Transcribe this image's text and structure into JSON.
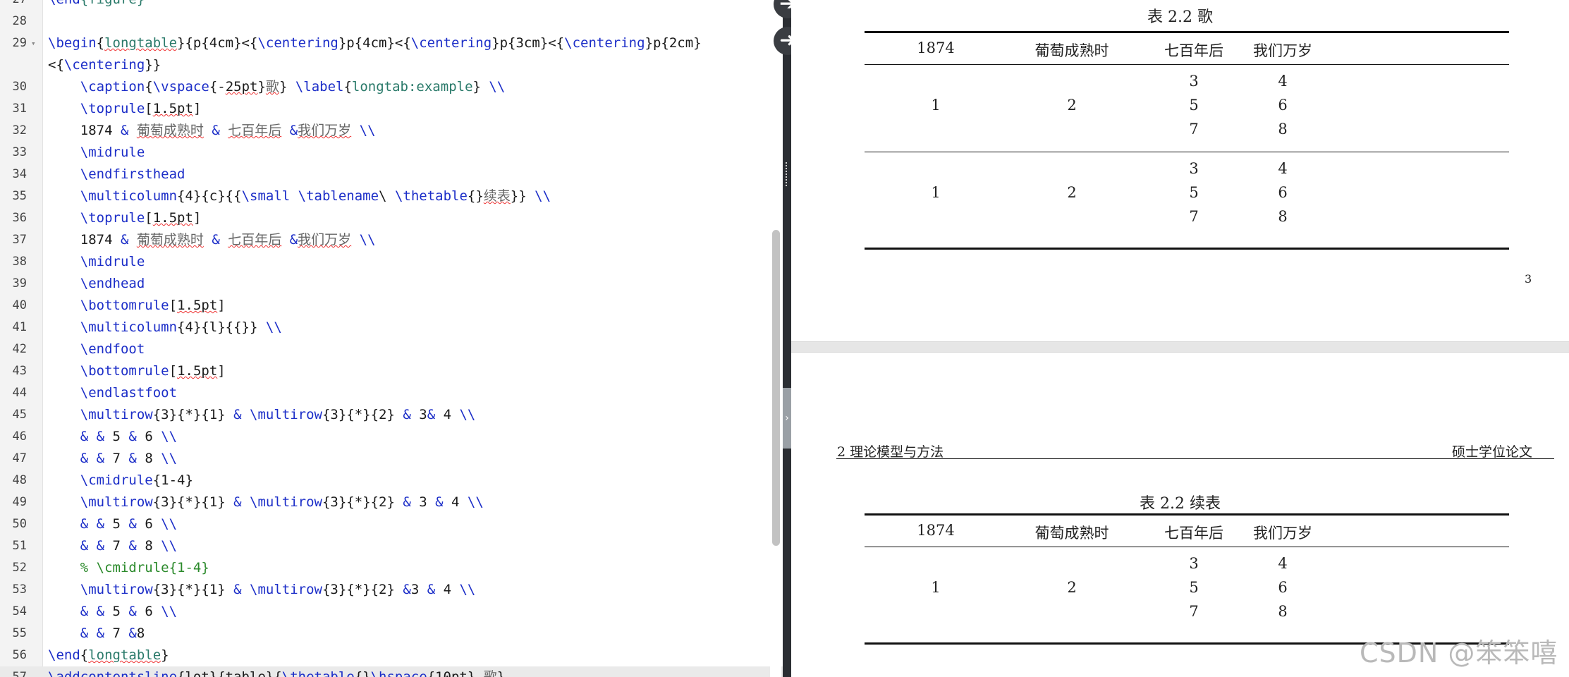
{
  "editor": {
    "lines": [
      {
        "num": "27",
        "fold": "",
        "segments": [
          {
            "t": "\\end",
            "c": "cmd"
          },
          {
            "t": "{figure}",
            "c": "arg"
          }
        ]
      },
      {
        "num": "28",
        "fold": "",
        "segments": []
      },
      {
        "num": "29",
        "fold": "▾",
        "segments": [
          {
            "t": "\\begin",
            "c": "cmd"
          },
          {
            "t": "{",
            "c": ""
          },
          {
            "t": "longtable",
            "c": "arg spl"
          },
          {
            "t": "}{p{4cm}<{",
            "c": ""
          },
          {
            "t": "\\centering",
            "c": "cmd"
          },
          {
            "t": "}p{4cm}<{",
            "c": ""
          },
          {
            "t": "\\centering",
            "c": "cmd"
          },
          {
            "t": "}p{3cm}<{",
            "c": ""
          },
          {
            "t": "\\centering",
            "c": "cmd"
          },
          {
            "t": "}p{2cm}",
            "c": ""
          }
        ]
      },
      {
        "num": "",
        "fold": "",
        "segments": [
          {
            "t": "<{",
            "c": ""
          },
          {
            "t": "\\centering",
            "c": "cmd"
          },
          {
            "t": "}}",
            "c": ""
          }
        ]
      },
      {
        "num": "30",
        "fold": "",
        "segments": [
          {
            "t": "    ",
            "c": ""
          },
          {
            "t": "\\caption",
            "c": "cmd"
          },
          {
            "t": "{",
            "c": ""
          },
          {
            "t": "\\vspace",
            "c": "cmd"
          },
          {
            "t": "{-",
            "c": ""
          },
          {
            "t": "25pt",
            "c": "spl"
          },
          {
            "t": "}",
            "c": ""
          },
          {
            "t": "歌",
            "c": "cjk"
          },
          {
            "t": "} ",
            "c": ""
          },
          {
            "t": "\\label",
            "c": "cmd"
          },
          {
            "t": "{",
            "c": ""
          },
          {
            "t": "longtab:example",
            "c": "arg"
          },
          {
            "t": "} ",
            "c": ""
          },
          {
            "t": "\\\\",
            "c": "cmd"
          }
        ]
      },
      {
        "num": "31",
        "fold": "",
        "segments": [
          {
            "t": "    ",
            "c": ""
          },
          {
            "t": "\\toprule",
            "c": "cmd"
          },
          {
            "t": "[",
            "c": ""
          },
          {
            "t": "1.5pt",
            "c": "spl"
          },
          {
            "t": "]",
            "c": ""
          }
        ]
      },
      {
        "num": "32",
        "fold": "",
        "segments": [
          {
            "t": "    1874 ",
            "c": ""
          },
          {
            "t": "&",
            "c": "amp"
          },
          {
            "t": " ",
            "c": ""
          },
          {
            "t": "葡萄成熟时",
            "c": "cjk"
          },
          {
            "t": " ",
            "c": ""
          },
          {
            "t": "&",
            "c": "amp"
          },
          {
            "t": " ",
            "c": ""
          },
          {
            "t": "七百年后",
            "c": "cjk"
          },
          {
            "t": " ",
            "c": ""
          },
          {
            "t": "&",
            "c": "amp"
          },
          {
            "t": "我们万岁",
            "c": "cjk"
          },
          {
            "t": " ",
            "c": ""
          },
          {
            "t": "\\\\",
            "c": "cmd"
          }
        ]
      },
      {
        "num": "33",
        "fold": "",
        "segments": [
          {
            "t": "    ",
            "c": ""
          },
          {
            "t": "\\midrule",
            "c": "cmd"
          }
        ]
      },
      {
        "num": "34",
        "fold": "",
        "segments": [
          {
            "t": "    ",
            "c": ""
          },
          {
            "t": "\\endfirsthead",
            "c": "cmd"
          }
        ]
      },
      {
        "num": "35",
        "fold": "",
        "segments": [
          {
            "t": "    ",
            "c": ""
          },
          {
            "t": "\\multicolumn",
            "c": "cmd"
          },
          {
            "t": "{4}{c}{{",
            "c": ""
          },
          {
            "t": "\\small",
            "c": "cmd"
          },
          {
            "t": " ",
            "c": ""
          },
          {
            "t": "\\tablename",
            "c": "cmd"
          },
          {
            "t": "\\ ",
            "c": ""
          },
          {
            "t": "\\thetable",
            "c": "cmd"
          },
          {
            "t": "{}",
            "c": ""
          },
          {
            "t": "续表",
            "c": "cjk"
          },
          {
            "t": "}} ",
            "c": ""
          },
          {
            "t": "\\\\",
            "c": "cmd"
          }
        ]
      },
      {
        "num": "36",
        "fold": "",
        "segments": [
          {
            "t": "    ",
            "c": ""
          },
          {
            "t": "\\toprule",
            "c": "cmd"
          },
          {
            "t": "[",
            "c": ""
          },
          {
            "t": "1.5pt",
            "c": "spl"
          },
          {
            "t": "]",
            "c": ""
          }
        ]
      },
      {
        "num": "37",
        "fold": "",
        "segments": [
          {
            "t": "    1874 ",
            "c": ""
          },
          {
            "t": "&",
            "c": "amp"
          },
          {
            "t": " ",
            "c": ""
          },
          {
            "t": "葡萄成熟时",
            "c": "cjk"
          },
          {
            "t": " ",
            "c": ""
          },
          {
            "t": "&",
            "c": "amp"
          },
          {
            "t": " ",
            "c": ""
          },
          {
            "t": "七百年后",
            "c": "cjk"
          },
          {
            "t": " ",
            "c": ""
          },
          {
            "t": "&",
            "c": "amp"
          },
          {
            "t": "我们万岁",
            "c": "cjk"
          },
          {
            "t": " ",
            "c": ""
          },
          {
            "t": "\\\\",
            "c": "cmd"
          }
        ]
      },
      {
        "num": "38",
        "fold": "",
        "segments": [
          {
            "t": "    ",
            "c": ""
          },
          {
            "t": "\\midrule",
            "c": "cmd"
          }
        ]
      },
      {
        "num": "39",
        "fold": "",
        "segments": [
          {
            "t": "    ",
            "c": ""
          },
          {
            "t": "\\endhead",
            "c": "cmd"
          }
        ]
      },
      {
        "num": "40",
        "fold": "",
        "segments": [
          {
            "t": "    ",
            "c": ""
          },
          {
            "t": "\\bottomrule",
            "c": "cmd"
          },
          {
            "t": "[",
            "c": ""
          },
          {
            "t": "1.5pt",
            "c": "spl"
          },
          {
            "t": "]",
            "c": ""
          }
        ]
      },
      {
        "num": "41",
        "fold": "",
        "segments": [
          {
            "t": "    ",
            "c": ""
          },
          {
            "t": "\\multicolumn",
            "c": "cmd"
          },
          {
            "t": "{4}{l}{{}} ",
            "c": ""
          },
          {
            "t": "\\\\",
            "c": "cmd"
          }
        ]
      },
      {
        "num": "42",
        "fold": "",
        "segments": [
          {
            "t": "    ",
            "c": ""
          },
          {
            "t": "\\endfoot",
            "c": "cmd"
          }
        ]
      },
      {
        "num": "43",
        "fold": "",
        "segments": [
          {
            "t": "    ",
            "c": ""
          },
          {
            "t": "\\bottomrule",
            "c": "cmd"
          },
          {
            "t": "[",
            "c": ""
          },
          {
            "t": "1.5pt",
            "c": "spl"
          },
          {
            "t": "]",
            "c": ""
          }
        ]
      },
      {
        "num": "44",
        "fold": "",
        "segments": [
          {
            "t": "    ",
            "c": ""
          },
          {
            "t": "\\endlastfoot",
            "c": "cmd"
          }
        ]
      },
      {
        "num": "45",
        "fold": "",
        "segments": [
          {
            "t": "    ",
            "c": ""
          },
          {
            "t": "\\multirow",
            "c": "cmd"
          },
          {
            "t": "{3}{*}{1} ",
            "c": ""
          },
          {
            "t": "&",
            "c": "amp"
          },
          {
            "t": " ",
            "c": ""
          },
          {
            "t": "\\multirow",
            "c": "cmd"
          },
          {
            "t": "{3}{*}{2} ",
            "c": ""
          },
          {
            "t": "&",
            "c": "amp"
          },
          {
            "t": " 3",
            "c": ""
          },
          {
            "t": "&",
            "c": "amp"
          },
          {
            "t": " 4 ",
            "c": ""
          },
          {
            "t": "\\\\",
            "c": "cmd"
          }
        ]
      },
      {
        "num": "46",
        "fold": "",
        "segments": [
          {
            "t": "    ",
            "c": ""
          },
          {
            "t": "& &",
            "c": "amp"
          },
          {
            "t": " 5 ",
            "c": ""
          },
          {
            "t": "&",
            "c": "amp"
          },
          {
            "t": " 6 ",
            "c": ""
          },
          {
            "t": "\\\\",
            "c": "cmd"
          }
        ]
      },
      {
        "num": "47",
        "fold": "",
        "segments": [
          {
            "t": "    ",
            "c": ""
          },
          {
            "t": "& &",
            "c": "amp"
          },
          {
            "t": " 7 ",
            "c": ""
          },
          {
            "t": "&",
            "c": "amp"
          },
          {
            "t": " 8 ",
            "c": ""
          },
          {
            "t": "\\\\",
            "c": "cmd"
          }
        ]
      },
      {
        "num": "48",
        "fold": "",
        "segments": [
          {
            "t": "    ",
            "c": ""
          },
          {
            "t": "\\cmidrule",
            "c": "cmd"
          },
          {
            "t": "{1-4}",
            "c": ""
          }
        ]
      },
      {
        "num": "49",
        "fold": "",
        "segments": [
          {
            "t": "    ",
            "c": ""
          },
          {
            "t": "\\multirow",
            "c": "cmd"
          },
          {
            "t": "{3}{*}{1} ",
            "c": ""
          },
          {
            "t": "&",
            "c": "amp"
          },
          {
            "t": " ",
            "c": ""
          },
          {
            "t": "\\multirow",
            "c": "cmd"
          },
          {
            "t": "{3}{*}{2} ",
            "c": ""
          },
          {
            "t": "&",
            "c": "amp"
          },
          {
            "t": " 3 ",
            "c": ""
          },
          {
            "t": "&",
            "c": "amp"
          },
          {
            "t": " 4 ",
            "c": ""
          },
          {
            "t": "\\\\",
            "c": "cmd"
          }
        ]
      },
      {
        "num": "50",
        "fold": "",
        "segments": [
          {
            "t": "    ",
            "c": ""
          },
          {
            "t": "& &",
            "c": "amp"
          },
          {
            "t": " 5 ",
            "c": ""
          },
          {
            "t": "&",
            "c": "amp"
          },
          {
            "t": " 6 ",
            "c": ""
          },
          {
            "t": "\\\\",
            "c": "cmd"
          }
        ]
      },
      {
        "num": "51",
        "fold": "",
        "segments": [
          {
            "t": "    ",
            "c": ""
          },
          {
            "t": "& &",
            "c": "amp"
          },
          {
            "t": " 7 ",
            "c": ""
          },
          {
            "t": "&",
            "c": "amp"
          },
          {
            "t": " 8 ",
            "c": ""
          },
          {
            "t": "\\\\",
            "c": "cmd"
          }
        ]
      },
      {
        "num": "52",
        "fold": "",
        "segments": [
          {
            "t": "    ",
            "c": ""
          },
          {
            "t": "% \\cmidrule{1-4}",
            "c": "com"
          }
        ]
      },
      {
        "num": "53",
        "fold": "",
        "segments": [
          {
            "t": "    ",
            "c": ""
          },
          {
            "t": "\\multirow",
            "c": "cmd"
          },
          {
            "t": "{3}{*}{1} ",
            "c": ""
          },
          {
            "t": "&",
            "c": "amp"
          },
          {
            "t": " ",
            "c": ""
          },
          {
            "t": "\\multirow",
            "c": "cmd"
          },
          {
            "t": "{3}{*}{2} ",
            "c": ""
          },
          {
            "t": "&",
            "c": "amp"
          },
          {
            "t": "3 ",
            "c": ""
          },
          {
            "t": "&",
            "c": "amp"
          },
          {
            "t": " 4 ",
            "c": ""
          },
          {
            "t": "\\\\",
            "c": "cmd"
          }
        ]
      },
      {
        "num": "54",
        "fold": "",
        "segments": [
          {
            "t": "    ",
            "c": ""
          },
          {
            "t": "& &",
            "c": "amp"
          },
          {
            "t": " 5 ",
            "c": ""
          },
          {
            "t": "&",
            "c": "amp"
          },
          {
            "t": " 6 ",
            "c": ""
          },
          {
            "t": "\\\\",
            "c": "cmd"
          }
        ]
      },
      {
        "num": "55",
        "fold": "",
        "segments": [
          {
            "t": "    ",
            "c": ""
          },
          {
            "t": "& &",
            "c": "amp"
          },
          {
            "t": " 7 ",
            "c": ""
          },
          {
            "t": "&",
            "c": "amp"
          },
          {
            "t": "8",
            "c": ""
          }
        ]
      },
      {
        "num": "56",
        "fold": "",
        "segments": [
          {
            "t": "\\end",
            "c": "cmd"
          },
          {
            "t": "{",
            "c": ""
          },
          {
            "t": "longtable",
            "c": "arg spl"
          },
          {
            "t": "}",
            "c": ""
          }
        ]
      },
      {
        "num": "57",
        "fold": "",
        "current": true,
        "segments": [
          {
            "t": "\\addcontentsline",
            "c": "cmd"
          },
          {
            "t": "{lot}{table}{",
            "c": ""
          },
          {
            "t": "\\thetable",
            "c": "cmd"
          },
          {
            "t": "{}",
            "c": ""
          },
          {
            "t": "\\hspace",
            "c": "cmd"
          },
          {
            "t": "{10pt} ",
            "c": ""
          },
          {
            "t": "歌",
            "c": "cjk"
          },
          {
            "t": "}",
            "c": ""
          }
        ]
      }
    ]
  },
  "preview": {
    "page1": {
      "caption": "表 2.2 歌",
      "headers": [
        "1874",
        "葡萄成熟时",
        "七百年后",
        "我们万岁"
      ],
      "groups": [
        {
          "c1": "1",
          "c2": "2",
          "rows": [
            [
              "3",
              "4"
            ],
            [
              "5",
              "6"
            ],
            [
              "7",
              "8"
            ]
          ]
        },
        {
          "c1": "1",
          "c2": "2",
          "rows": [
            [
              "3",
              "4"
            ],
            [
              "5",
              "6"
            ],
            [
              "7",
              "8"
            ]
          ]
        }
      ],
      "page_number": "3"
    },
    "page2": {
      "running_left": "2   理论模型与方法",
      "running_right": "硕士学位论文",
      "caption": "表 2.2 续表",
      "headers": [
        "1874",
        "葡萄成熟时",
        "七百年后",
        "我们万岁"
      ],
      "groups": [
        {
          "c1": "1",
          "c2": "2",
          "rows": [
            [
              "3",
              "4"
            ],
            [
              "5",
              "6"
            ],
            [
              "7",
              "8"
            ]
          ]
        }
      ]
    }
  },
  "icons": {
    "nav_forward": "arrow-right-icon",
    "nav_back": "arrow-left-icon",
    "split": "chevron-right-icon"
  },
  "watermark": "CSDN @笨笨嘻",
  "colors": {
    "command": "#1c2ec8",
    "argument": "#2a7a6a",
    "comment": "#2b8a2b",
    "splitter": "#2b2e33"
  }
}
